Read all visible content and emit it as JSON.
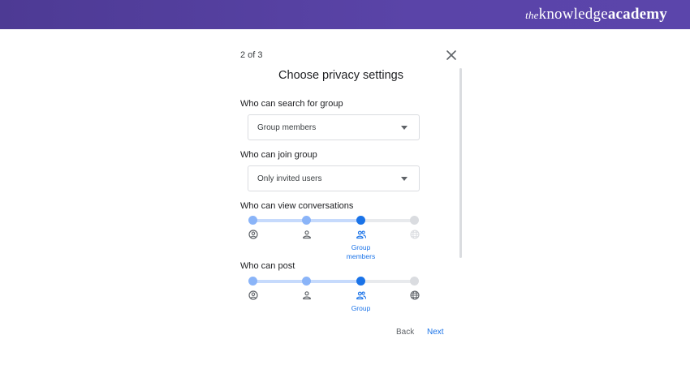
{
  "banner": {
    "brand_the": "the",
    "brand_knowledge": "knowledge",
    "brand_academy": "academy"
  },
  "dialog": {
    "step": "2 of 3",
    "title": "Choose privacy settings",
    "search": {
      "label": "Who can search for group",
      "value": "Group members"
    },
    "join": {
      "label": "Who can join group",
      "value": "Only invited users"
    },
    "view": {
      "label": "Who can view conversations",
      "selected_index": 2,
      "selected_label": "Group members",
      "options": [
        "person-circle-icon",
        "person-icon",
        "group-icon",
        "globe-icon"
      ]
    },
    "post": {
      "label": "Who can post",
      "selected_index": 2,
      "selected_label": "Group",
      "options": [
        "person-circle-icon",
        "person-icon",
        "group-icon",
        "globe-icon"
      ]
    },
    "back_label": "Back",
    "next_label": "Next"
  },
  "colors": {
    "banner": "#5a44a8",
    "accent": "#1a73e8",
    "accent_light": "#8ab4f8",
    "track_fill": "#c6dafc",
    "inactive": "#dadce0"
  }
}
